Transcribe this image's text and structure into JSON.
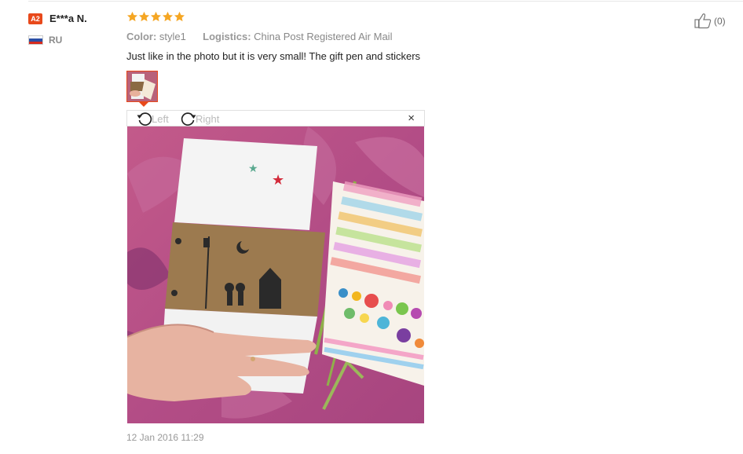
{
  "review": {
    "reviewer": {
      "level_badge": "A2",
      "name": "E***a N.",
      "country": "RU"
    },
    "rating": {
      "value": 5,
      "max": 5
    },
    "attributes": {
      "color_label": "Color:",
      "color_value": "style1",
      "logistics_label": "Logistics:",
      "logistics_value": "China Post Registered Air Mail"
    },
    "text": "Just like in the photo but it is very small! The gift pen and stickers",
    "viewer": {
      "rotate_left_label": "Left",
      "rotate_right_label": "Right",
      "close_label": "×"
    },
    "date": "12 Jan 2016 11:29",
    "helpful": {
      "count_text": "(0)"
    }
  },
  "colors": {
    "accent": "#e8491b",
    "star": "#f5a623",
    "muted": "#999999"
  },
  "icons": [
    "level-badge",
    "russia-flag-icon",
    "star-icon",
    "rotate-left-icon",
    "rotate-right-icon",
    "close-icon",
    "thumbs-up-icon"
  ]
}
